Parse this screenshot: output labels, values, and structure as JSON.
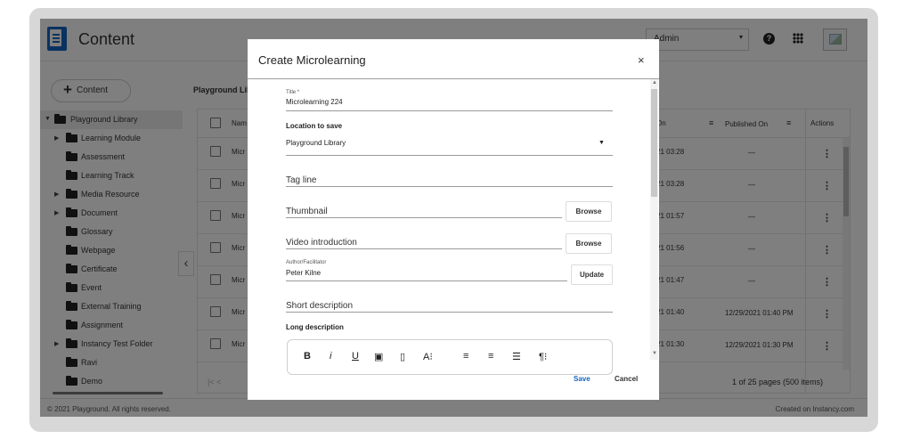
{
  "header": {
    "app_title": "Content",
    "role": "Admin",
    "help_icon": "help-icon",
    "apps_icon": "apps-grid-icon"
  },
  "toolbar": {
    "content_button": "Content",
    "breadcrumb": "Playground Libr"
  },
  "sidebar": {
    "items": [
      {
        "label": "Playground Library",
        "selected": true,
        "expandable": true
      },
      {
        "label": "Learning Module",
        "expandable": true
      },
      {
        "label": "Assessment"
      },
      {
        "label": "Learning Track"
      },
      {
        "label": "Media Resource",
        "expandable": true
      },
      {
        "label": "Document",
        "expandable": true
      },
      {
        "label": "Glossary"
      },
      {
        "label": "Webpage"
      },
      {
        "label": "Certificate"
      },
      {
        "label": "Event"
      },
      {
        "label": "External Training"
      },
      {
        "label": "Assignment"
      },
      {
        "label": "Instancy Test Folder",
        "expandable": true
      },
      {
        "label": "Ravi"
      },
      {
        "label": "Demo"
      }
    ]
  },
  "table": {
    "columns": {
      "name": "Nam",
      "modified_on": "On",
      "published_on": "Published On",
      "actions": "Actions"
    },
    "rows": [
      {
        "name": "Micr",
        "modified": "21 03:28",
        "published": "—"
      },
      {
        "name": "Micr",
        "modified": "21 03:28",
        "published": "—"
      },
      {
        "name": "Micr",
        "modified": "21 01:57",
        "published": "—"
      },
      {
        "name": "Micr",
        "modified": "21 01:56",
        "published": "—"
      },
      {
        "name": "Micr",
        "modified": "21 01:47",
        "published": "—"
      },
      {
        "name": "Micr",
        "modified": "21 01:40",
        "published": "12/29/2021 01:40 PM"
      },
      {
        "name": "Micr",
        "modified": "21 01:30",
        "published": "12/29/2021 01:30 PM"
      }
    ],
    "pager_left": "|<   <",
    "pager": "1 of 25 pages (500 items)"
  },
  "footer": {
    "copyright": "© 2021 Playground. All rights reserved.",
    "credit": "Created on Instancy.com"
  },
  "modal": {
    "title": "Create Microlearning",
    "close": "×",
    "title_field_label": "Title *",
    "title_field_value": "Microlearning 224",
    "location_label": "Location to save",
    "location_value": "Playground Library",
    "tagline_label": "Tag line",
    "thumbnail_label": "Thumbnail",
    "thumbnail_button": "Browse",
    "video_label": "Video introduction",
    "video_button": "Browse",
    "author_label": "Author/Facilitator",
    "author_value": "Peter Kilne",
    "author_button": "Update",
    "short_desc_label": "Short description",
    "long_desc_label": "Long description",
    "save": "Save",
    "cancel": "Cancel"
  }
}
